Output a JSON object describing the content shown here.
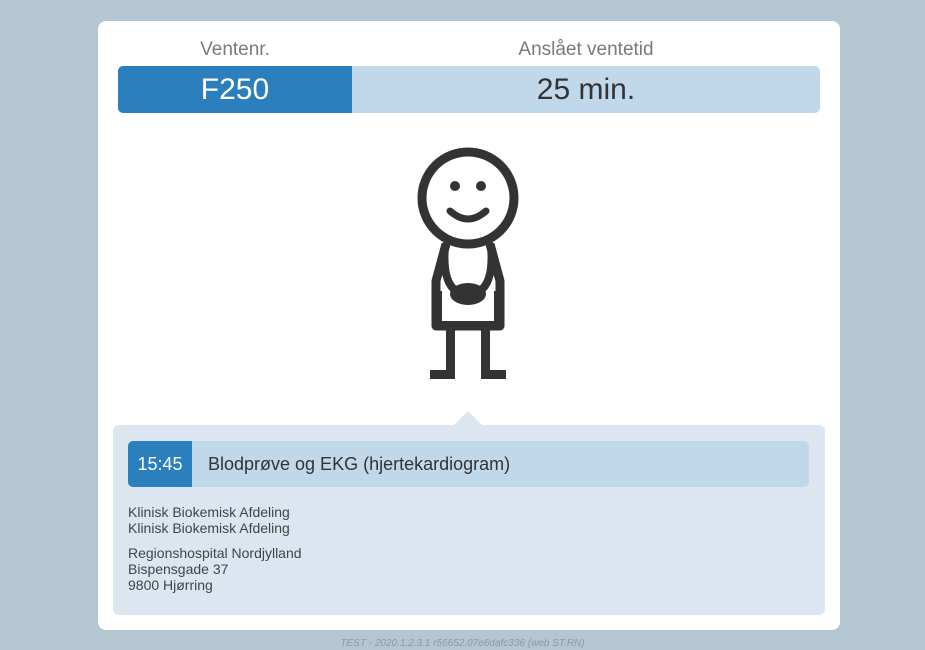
{
  "queue": {
    "number_label": "Ventenr.",
    "number_value": "F250",
    "wait_label": "Anslået ventetid",
    "wait_value": "25 min."
  },
  "appointment": {
    "time": "15:45",
    "title": "Blodprøve og EKG (hjertekardiogram)",
    "department_lines": [
      "Klinisk Biokemisk Afdeling",
      "Klinisk Biokemisk Afdeling"
    ],
    "address_lines": [
      "Regionshospital Nordjylland",
      "Bispensgade 37",
      "9800 Hjørring"
    ]
  },
  "footer": {
    "version": "TEST - 2020.1.2.3.1 r56652.07e6dafc336 (web ST.RN)"
  },
  "colors": {
    "accent": "#2a7fbc",
    "accent_light": "#c0d8ea",
    "info_bg": "#dbe6f0",
    "page_bg": "#b4c6d2"
  },
  "icons": {
    "figure": "waiting-person-icon"
  }
}
